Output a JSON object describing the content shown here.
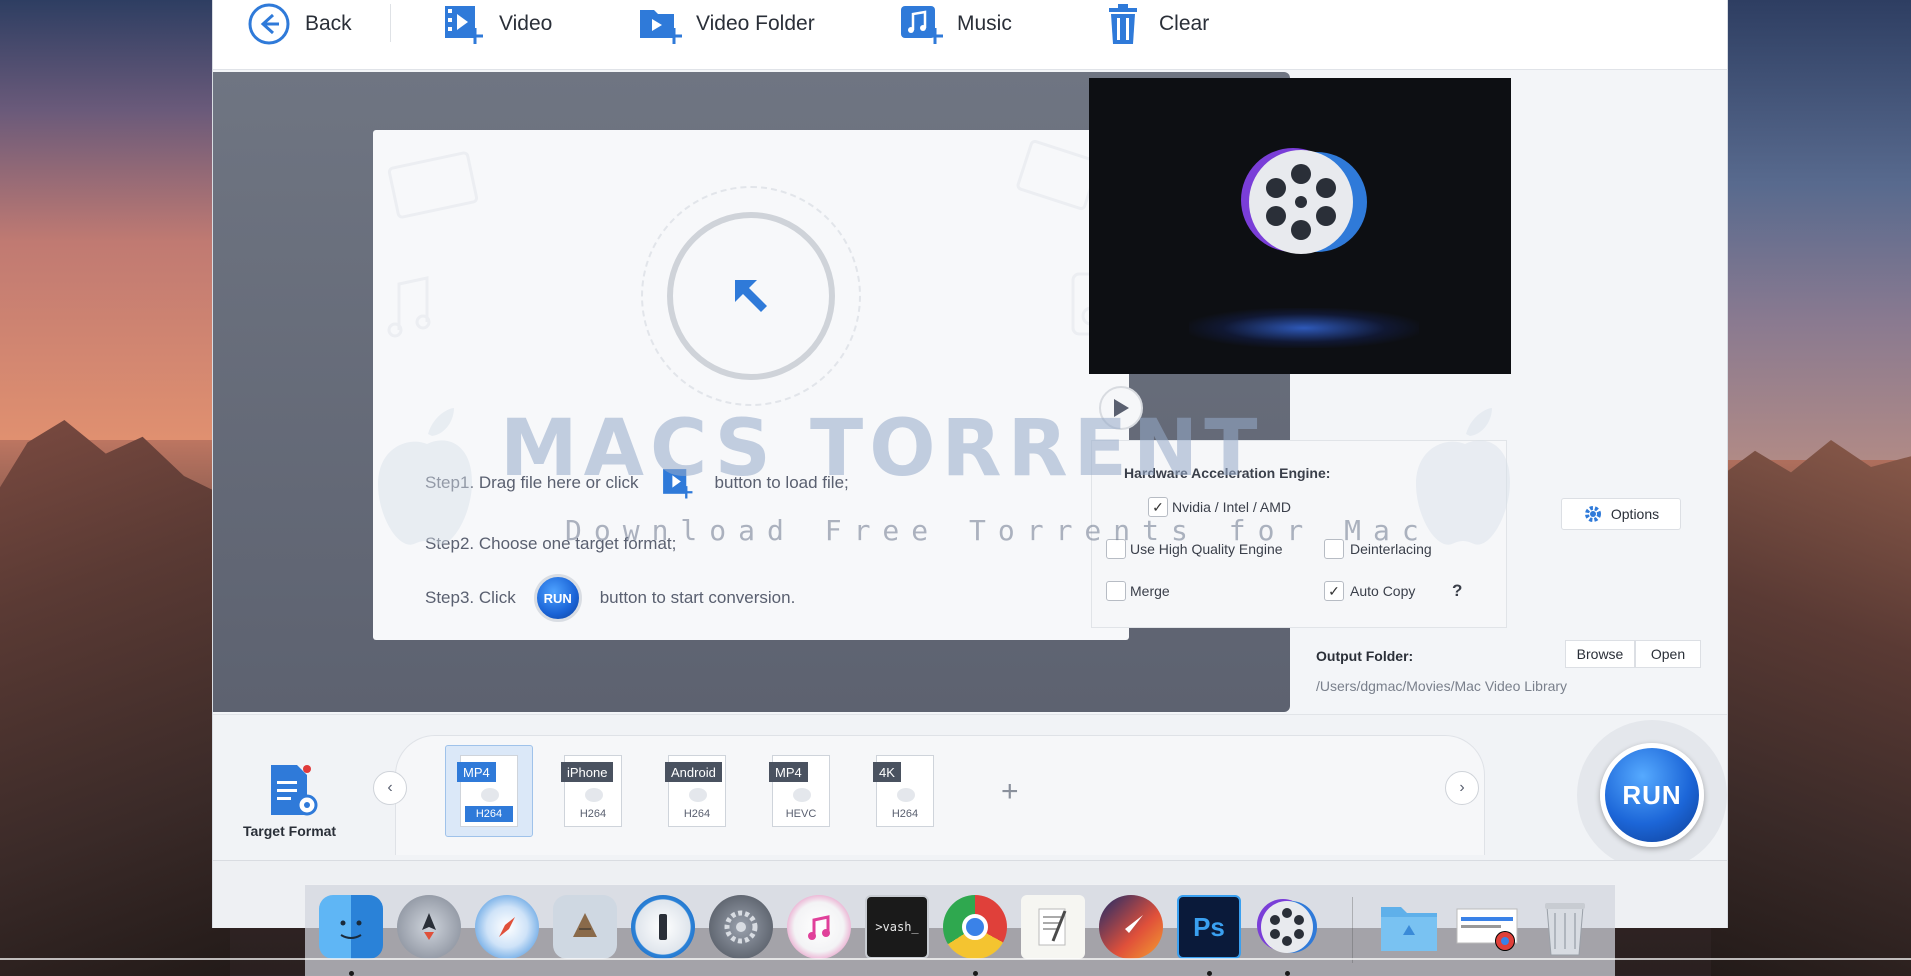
{
  "toolbar": {
    "back": "Back",
    "video": "Video",
    "video_folder": "Video Folder",
    "music": "Music",
    "clear": "Clear"
  },
  "drop": {
    "step1_a": "Step1. Drag file here or click",
    "step1_b": "button to load file;",
    "step2": "Step2. Choose one target format;",
    "step3_a": "Step3. Click",
    "step3_b": "button to start conversion.",
    "run_mini": "RUN"
  },
  "settings": {
    "hw_title": "Hardware Acceleration Engine:",
    "gpu": "Nvidia / Intel / AMD",
    "gpu_checked": true,
    "options": "Options",
    "hq_engine": "Use High Quality Engine",
    "hq_checked": false,
    "deinterlacing": "Deinterlacing",
    "deinterlacing_checked": false,
    "merge": "Merge",
    "merge_checked": false,
    "auto_copy": "Auto Copy",
    "auto_copy_checked": true,
    "help": "?"
  },
  "output": {
    "label": "Output Folder:",
    "path": "/Users/dgmac/Movies/Mac Video Library",
    "browse": "Browse",
    "open": "Open"
  },
  "formats": {
    "target_label": "Target Format",
    "items": [
      {
        "top": "MP4",
        "bottom": "H264",
        "selected": true
      },
      {
        "top": "iPhone",
        "bottom": "H264",
        "selected": false
      },
      {
        "top": "Android",
        "bottom": "H264",
        "selected": false
      },
      {
        "top": "MP4",
        "bottom": "HEVC",
        "selected": false
      },
      {
        "top": "4K",
        "bottom": "H264",
        "selected": false
      }
    ],
    "add": "+"
  },
  "run_button": "RUN",
  "watermark": {
    "title": "MACS TORRENT",
    "subtitle": "Download Free Torrents for Mac"
  },
  "dock": {
    "terminal_text": ">vash_",
    "photoshop_text": "Ps",
    "apps": [
      "finder-icon",
      "launchpad-icon",
      "safari-icon",
      "mail-icon",
      "1password-icon",
      "system-preferences-icon",
      "itunes-icon",
      "terminal-icon",
      "chrome-icon",
      "textedit-icon",
      "rocket-typist-icon",
      "photoshop-icon",
      "videoproc-icon",
      "folder-icon",
      "preview-icon",
      "trash-icon"
    ]
  },
  "colors": {
    "accent": "#2f7ad9",
    "run_blue": "#1c66d8",
    "drop_bg": "#6a707d"
  }
}
